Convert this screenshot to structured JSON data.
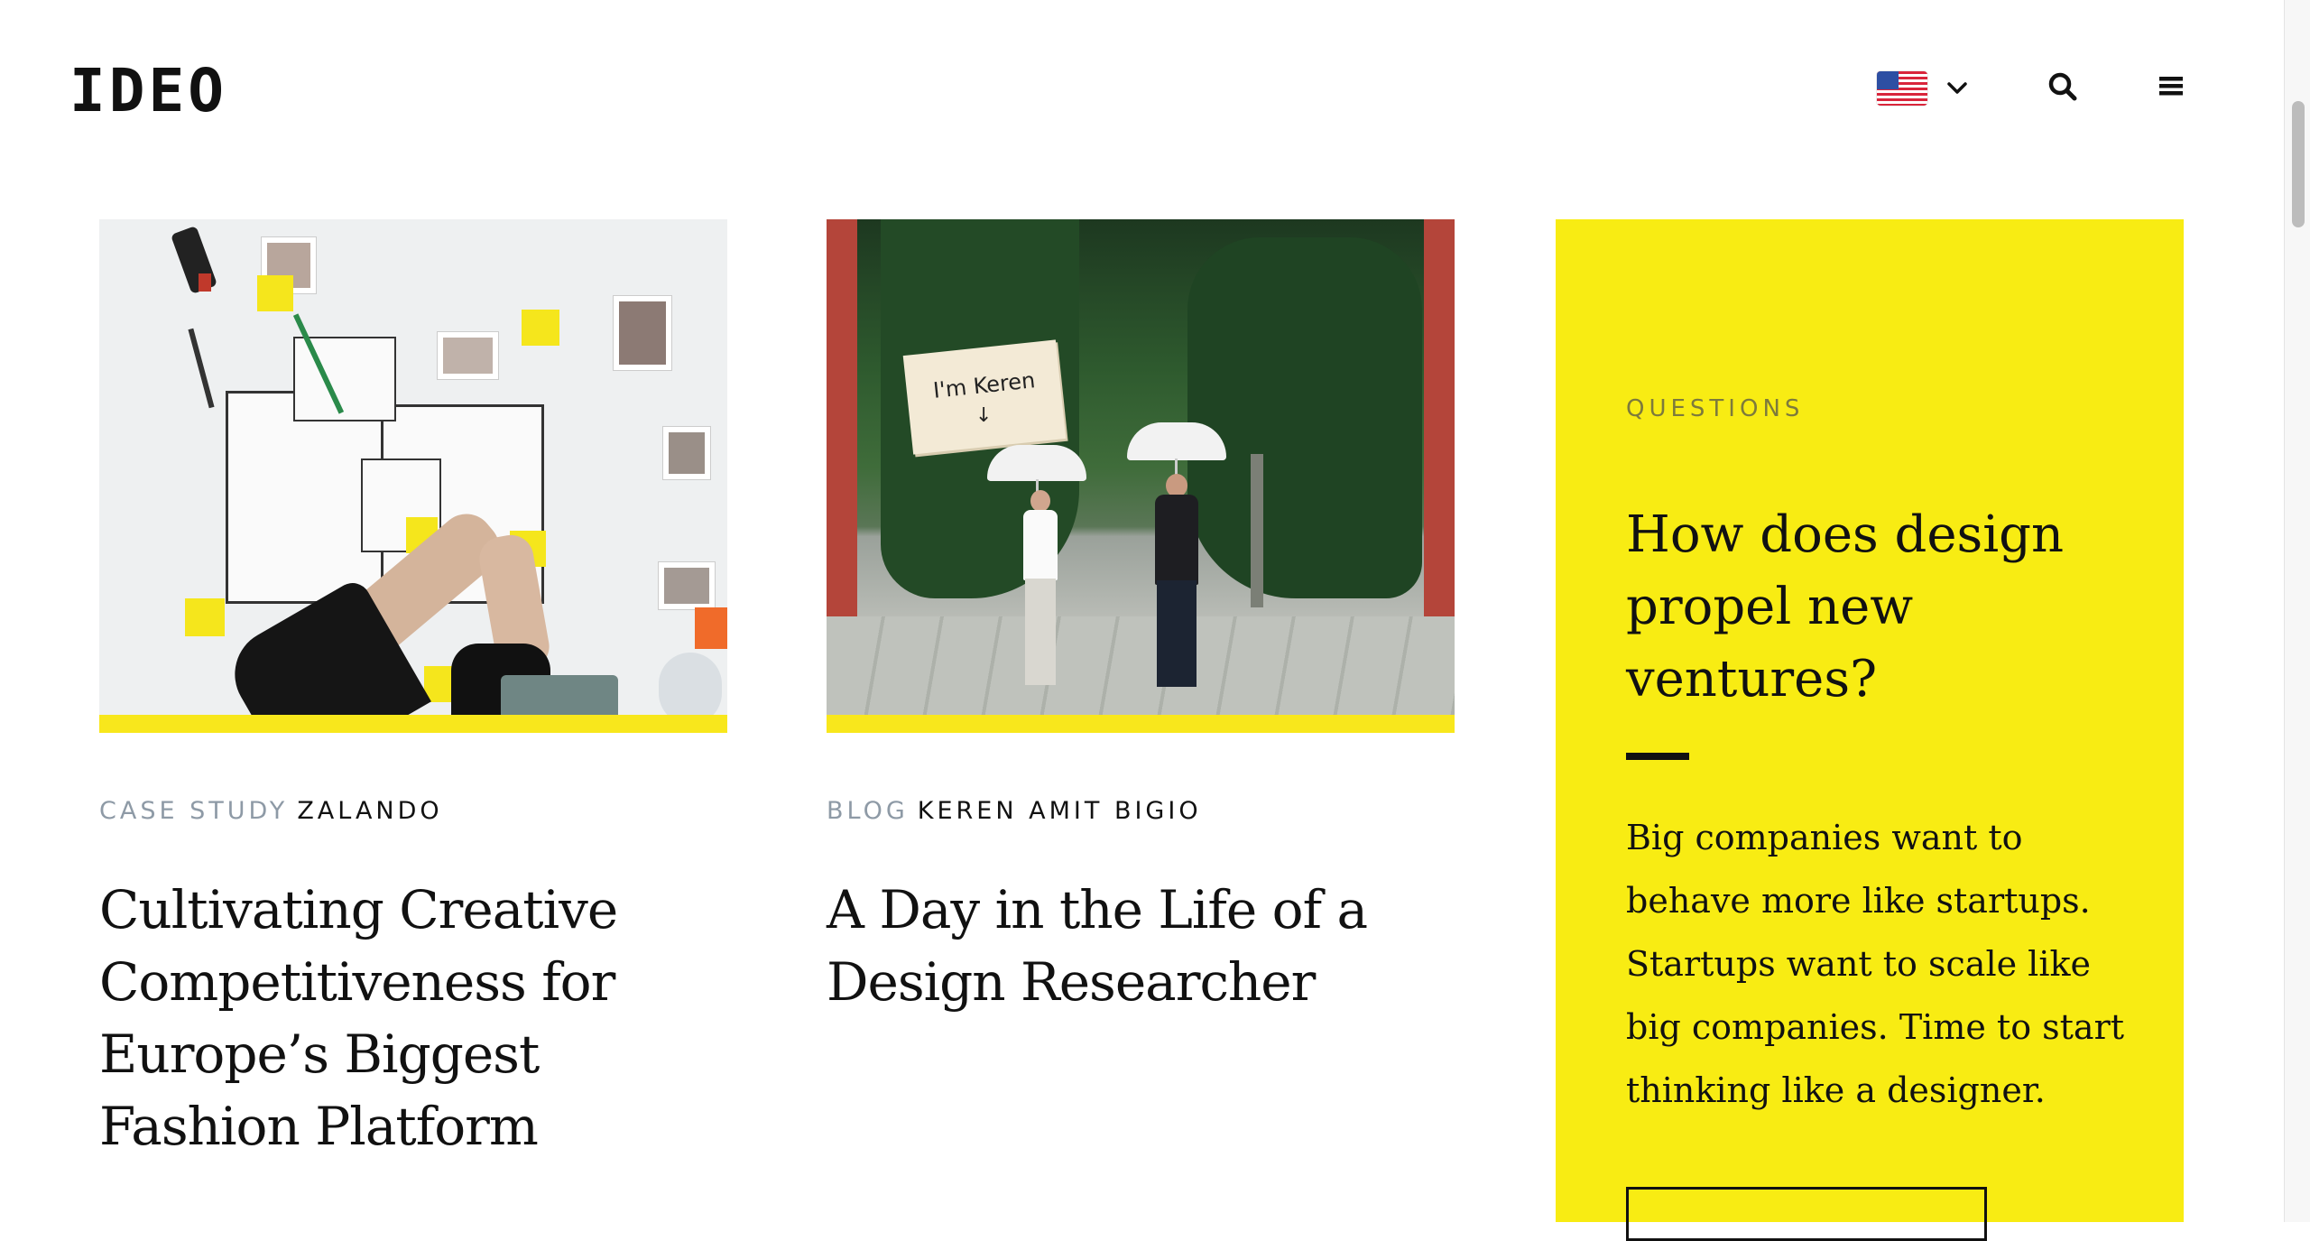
{
  "header": {
    "logo": "IDEO",
    "locale": {
      "flag_icon": "us-flag-icon",
      "chevron_icon": "chevron-down-icon"
    },
    "search_icon": "search-icon",
    "menu_icon": "hamburger-menu-icon"
  },
  "cards": [
    {
      "type": "CASE STUDY",
      "name": "ZALANDO",
      "title": "Cultivating Creative Competitiveness for Europe’s Biggest Fashion Platform"
    },
    {
      "type": "BLOG",
      "name": "KEREN AMIT BIGIO",
      "title": "A Day in the Life of a Design Researcher",
      "image_sign": "I'm Keren"
    }
  ],
  "panel": {
    "eyebrow": "QUESTIONS",
    "title": "How does design propel new ventures?",
    "body": "Big companies want to behave more like startups. Startups want to scale like big companies. Time to start thinking like a designer.",
    "background": "#f8ec13"
  },
  "colors": {
    "accent_yellow": "#f8e71c",
    "meta_gray": "#8e9aa6",
    "text": "#111111"
  }
}
